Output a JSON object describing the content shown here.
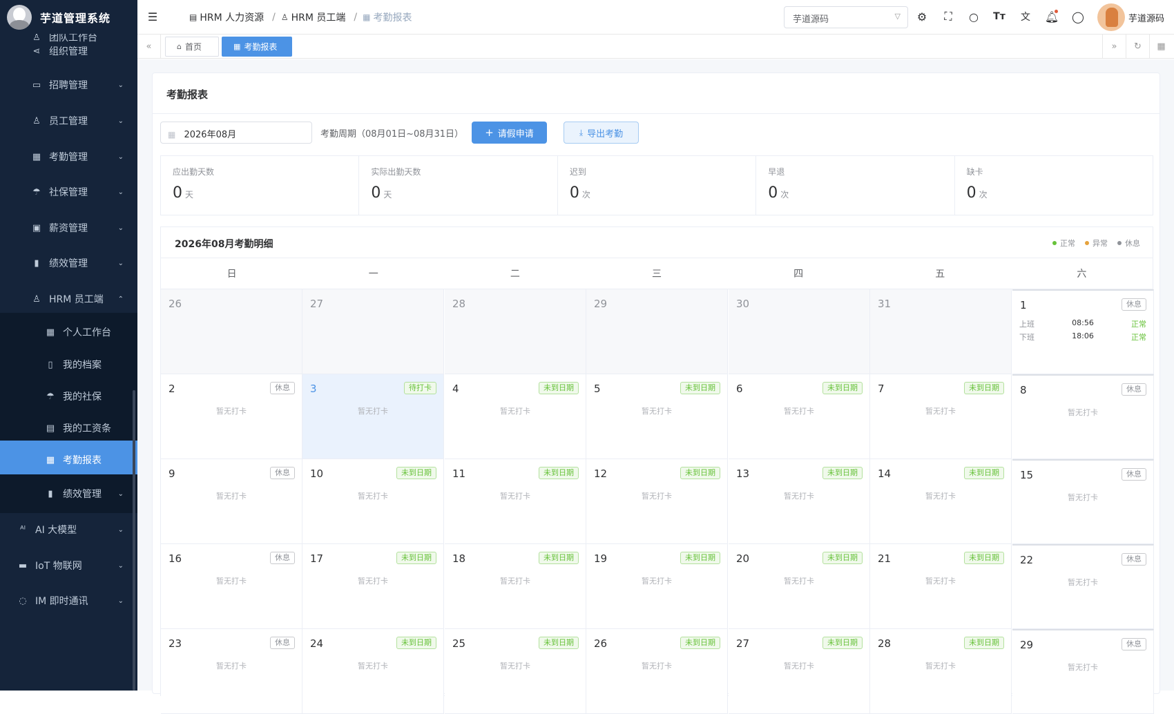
{
  "app": {
    "title": "芋道管理系统"
  },
  "sidebar": {
    "items": [
      {
        "label": "团队工作台",
        "icon": "user-icon"
      },
      {
        "label": "组织管理",
        "icon": "share-icon"
      },
      {
        "label": "招聘管理",
        "icon": "briefcase-icon"
      },
      {
        "label": "员工管理",
        "icon": "user-icon"
      },
      {
        "label": "考勤管理",
        "icon": "calendar-icon"
      },
      {
        "label": "社保管理",
        "icon": "umbrella-icon"
      },
      {
        "label": "薪资管理",
        "icon": "wallet-icon"
      },
      {
        "label": "绩效管理",
        "icon": "bar-chart-icon"
      },
      {
        "label": "HRM 员工端",
        "icon": "user-icon"
      },
      {
        "label": "个人工作台",
        "icon": "calendar-icon"
      },
      {
        "label": "我的档案",
        "icon": "file-icon"
      },
      {
        "label": "我的社保",
        "icon": "umbrella-icon"
      },
      {
        "label": "我的工资条",
        "icon": "document-icon"
      },
      {
        "label": "考勤报表",
        "icon": "calendar-icon"
      },
      {
        "label": "绩效管理",
        "icon": "bar-chart-icon"
      },
      {
        "label": "AI 大模型",
        "icon": "ai-icon"
      },
      {
        "label": "IoT 物联网",
        "icon": "router-icon"
      },
      {
        "label": "IM 即时通讯",
        "icon": "chat-icon"
      }
    ]
  },
  "header": {
    "breadcrumb": [
      "HRM 人力资源",
      "HRM 员工端",
      "考勤报表"
    ],
    "tenant": "芋道源码",
    "user": "芋道源码"
  },
  "tabs": [
    "首页",
    "考勤报表"
  ],
  "page": {
    "title": "考勤报表",
    "month": "2026年08月",
    "period": "考勤周期（08月01日~08月31日）",
    "leave_button": "请假申请",
    "export_button": "导出考勤"
  },
  "stats": [
    {
      "label": "应出勤天数",
      "value": "0",
      "unit": "天"
    },
    {
      "label": "实际出勤天数",
      "value": "0",
      "unit": "天"
    },
    {
      "label": "迟到",
      "value": "0",
      "unit": "次"
    },
    {
      "label": "早退",
      "value": "0",
      "unit": "次"
    },
    {
      "label": "缺卡",
      "value": "0",
      "unit": "次"
    }
  ],
  "calendar": {
    "title": "2026年08月考勤明细",
    "legend": [
      {
        "label": "正常",
        "color": "#67c23a"
      },
      {
        "label": "异常",
        "color": "#e6a23c"
      },
      {
        "label": "休息",
        "color": "#909399"
      }
    ],
    "weekdays": [
      "日",
      "一",
      "二",
      "三",
      "四",
      "五",
      "六"
    ],
    "no_punch": "暂无打卡",
    "clock_in_label": "上班",
    "clock_out_label": "下班",
    "weeks": [
      [
        {
          "day": "26",
          "out": true
        },
        {
          "day": "27",
          "out": true
        },
        {
          "day": "28",
          "out": true
        },
        {
          "day": "29",
          "out": true
        },
        {
          "day": "30",
          "out": true
        },
        {
          "day": "31",
          "out": true
        },
        {
          "day": "1",
          "badge": "休息",
          "type": "rest",
          "in": "08:56",
          "in_status": "正常",
          "off": "18:06",
          "off_status": "正常"
        }
      ],
      [
        {
          "day": "2",
          "badge": "休息",
          "type": "rest"
        },
        {
          "day": "3",
          "badge": "待打卡",
          "type": "todo",
          "today": true
        },
        {
          "day": "4",
          "badge": "未到日期",
          "type": "future"
        },
        {
          "day": "5",
          "badge": "未到日期",
          "type": "future"
        },
        {
          "day": "6",
          "badge": "未到日期",
          "type": "future"
        },
        {
          "day": "7",
          "badge": "未到日期",
          "type": "future"
        },
        {
          "day": "8",
          "badge": "休息",
          "type": "rest"
        }
      ],
      [
        {
          "day": "9",
          "badge": "休息",
          "type": "rest"
        },
        {
          "day": "10",
          "badge": "未到日期",
          "type": "future"
        },
        {
          "day": "11",
          "badge": "未到日期",
          "type": "future"
        },
        {
          "day": "12",
          "badge": "未到日期",
          "type": "future"
        },
        {
          "day": "13",
          "badge": "未到日期",
          "type": "future"
        },
        {
          "day": "14",
          "badge": "未到日期",
          "type": "future"
        },
        {
          "day": "15",
          "badge": "休息",
          "type": "rest"
        }
      ],
      [
        {
          "day": "16",
          "badge": "休息",
          "type": "rest"
        },
        {
          "day": "17",
          "badge": "未到日期",
          "type": "future"
        },
        {
          "day": "18",
          "badge": "未到日期",
          "type": "future"
        },
        {
          "day": "19",
          "badge": "未到日期",
          "type": "future"
        },
        {
          "day": "20",
          "badge": "未到日期",
          "type": "future"
        },
        {
          "day": "21",
          "badge": "未到日期",
          "type": "future"
        },
        {
          "day": "22",
          "badge": "休息",
          "type": "rest"
        }
      ],
      [
        {
          "day": "23",
          "badge": "休息",
          "type": "rest"
        },
        {
          "day": "24",
          "badge": "未到日期",
          "type": "future"
        },
        {
          "day": "25",
          "badge": "未到日期",
          "type": "future"
        },
        {
          "day": "26",
          "badge": "未到日期",
          "type": "future"
        },
        {
          "day": "27",
          "badge": "未到日期",
          "type": "future"
        },
        {
          "day": "28",
          "badge": "未到日期",
          "type": "future"
        },
        {
          "day": "29",
          "badge": "休息",
          "type": "rest"
        }
      ]
    ]
  }
}
